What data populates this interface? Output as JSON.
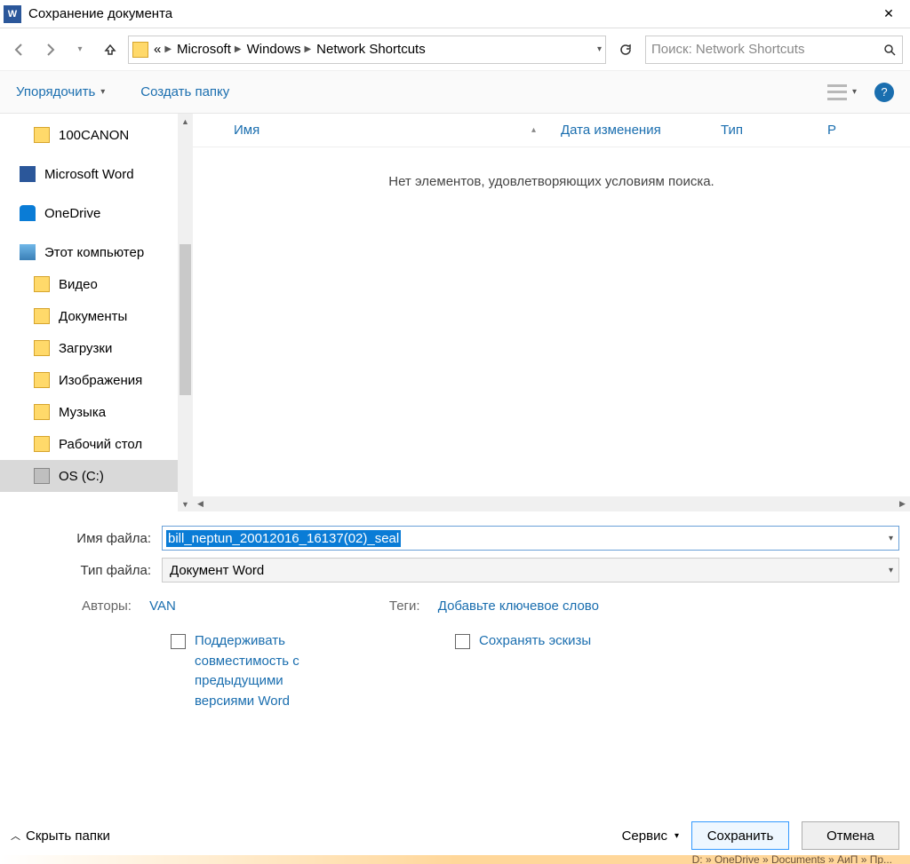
{
  "window": {
    "title": "Сохранение документа",
    "app_abbrev": "W"
  },
  "nav": {
    "breadcrumbs": [
      "«",
      "Microsoft",
      "Windows",
      "Network Shortcuts"
    ],
    "search_placeholder": "Поиск: Network Shortcuts"
  },
  "toolbar": {
    "organise": "Упорядочить",
    "new_folder": "Создать папку"
  },
  "columns": {
    "name": "Имя",
    "date": "Дата изменения",
    "type": "Тип",
    "size": "Р"
  },
  "sidebar": {
    "items": [
      {
        "label": "100CANON",
        "icon": "folder",
        "level": 1
      },
      {
        "label": "Microsoft Word",
        "icon": "word",
        "level": 0
      },
      {
        "label": "OneDrive",
        "icon": "onedrive",
        "level": 0
      },
      {
        "label": "Этот компьютер",
        "icon": "pc",
        "level": 0
      },
      {
        "label": "Видео",
        "icon": "folder",
        "level": 1
      },
      {
        "label": "Документы",
        "icon": "folder",
        "level": 1
      },
      {
        "label": "Загрузки",
        "icon": "folder",
        "level": 1
      },
      {
        "label": "Изображения",
        "icon": "folder",
        "level": 1
      },
      {
        "label": "Музыка",
        "icon": "folder",
        "level": 1
      },
      {
        "label": "Рабочий стол",
        "icon": "folder",
        "level": 1
      },
      {
        "label": "OS (C:)",
        "icon": "drive",
        "level": 1,
        "selected": true
      }
    ]
  },
  "content": {
    "empty_message": "Нет элементов, удовлетворяющих условиям поиска."
  },
  "fields": {
    "filename_label": "Имя файла:",
    "filename_value": "bill_neptun_20012016_16137(02)_seal",
    "filetype_label": "Тип файла:",
    "filetype_value": "Документ Word",
    "authors_label": "Авторы:",
    "authors_value": "VAN",
    "tags_label": "Теги:",
    "tags_value": "Добавьте ключевое слово"
  },
  "checkboxes": {
    "compat": "Поддерживать совместимость с предыдущими версиями Word",
    "thumbs": "Сохранять эскизы"
  },
  "footer": {
    "hide_folders": "Скрыть папки",
    "service": "Сервис",
    "save": "Сохранить",
    "cancel": "Отмена"
  },
  "statusbar_hint": "D: » OneDrive » Documents » АиП » Пр..."
}
